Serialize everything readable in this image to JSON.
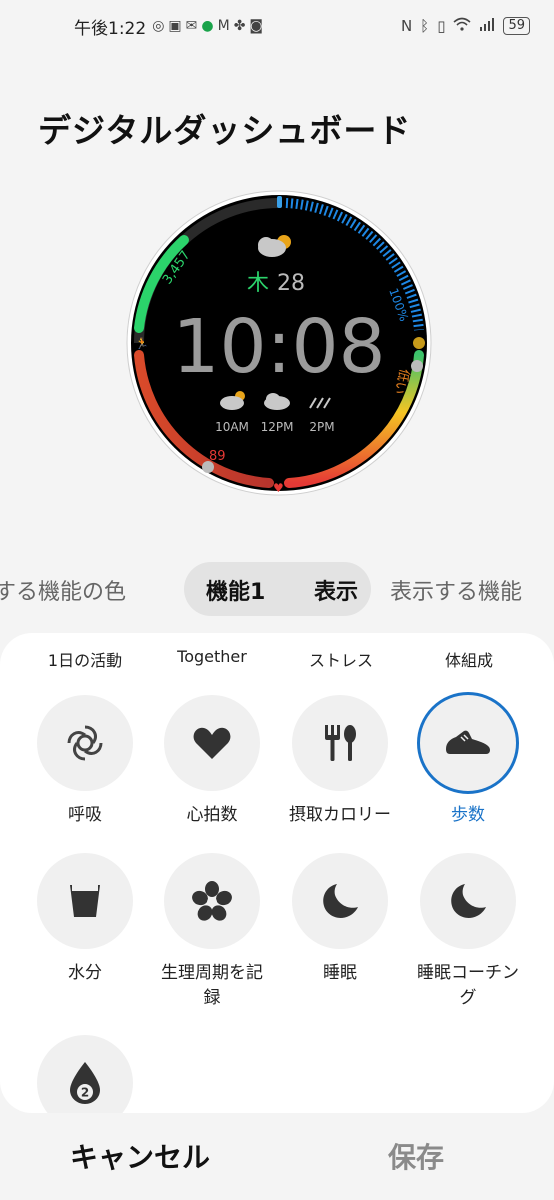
{
  "status_bar": {
    "time": "午後1:22",
    "battery": "59",
    "icons_left": [
      "target-icon",
      "calendar-icon",
      "mail-icon",
      "app-icon",
      "gmail-icon",
      "fan-icon",
      "cat-icon"
    ],
    "icons_right": [
      "nfc-icon",
      "bluetooth-icon",
      "vibrate-icon",
      "wifi-icon",
      "signal-icon"
    ]
  },
  "page_title": "デジタルダッシュボード",
  "watch_face": {
    "steps": "3,457",
    "day_kanji": "木",
    "date": "28",
    "time": "10:08",
    "battery": "100%",
    "stress": "低い",
    "heart_rate": "89",
    "forecast": [
      {
        "time": "10AM",
        "icon": "cloud-sun-icon"
      },
      {
        "time": "12PM",
        "icon": "cloud-icon"
      },
      {
        "time": "2PM",
        "icon": "rain-icon"
      }
    ],
    "colors": {
      "steps": "#2bd36b",
      "battery": "#1e88e5",
      "heart": "#e53935",
      "stress": "#f5a623",
      "background": "#000000"
    }
  },
  "tabs": {
    "left_partial": "する機能の色",
    "selected": "機能1",
    "next_in_pill": "表示",
    "right_partial": "表示する機能"
  },
  "categories": [
    "1日の活動",
    "Together",
    "ストレス",
    "体組成"
  ],
  "features": [
    {
      "label": "呼吸",
      "icon": "breathe-icon",
      "selected": false
    },
    {
      "label": "心拍数",
      "icon": "heart-icon",
      "selected": false
    },
    {
      "label": "摂取カロリー",
      "icon": "fork-knife-icon",
      "selected": false
    },
    {
      "label": "歩数",
      "icon": "shoe-icon",
      "selected": true
    },
    {
      "label": "水分",
      "icon": "cup-icon",
      "selected": false
    },
    {
      "label": "生理周期を記録",
      "icon": "flower-icon",
      "selected": false
    },
    {
      "label": "睡眠",
      "icon": "moon-icon",
      "selected": false
    },
    {
      "label": "睡眠コーチング",
      "icon": "moon-icon",
      "selected": false
    },
    {
      "label": "",
      "icon": "drop-icon",
      "badge": "2",
      "selected": false
    }
  ],
  "buttons": {
    "cancel": "キャンセル",
    "save": "保存"
  },
  "accent_color": "#1a73c8"
}
